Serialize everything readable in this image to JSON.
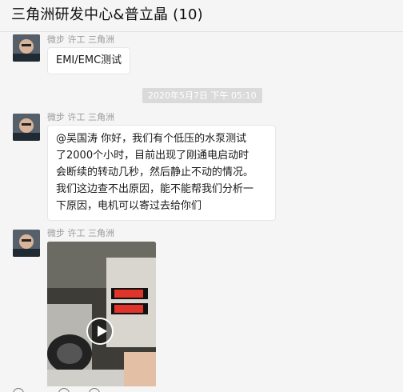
{
  "window": {
    "title": "三角洲研发中心&普立晶 (10)"
  },
  "messages": [
    {
      "sender": "微步  许工 三角洲",
      "text": "EMI/EMC测试"
    },
    {
      "sender": "微步  许工 三角洲",
      "lines": [
        "@吴国涛 你好，我们有个低压的水泵测试",
        "了2000个小时，目前出现了刚通电启动时",
        "会断续的转动几秒，然后静止不动的情况。",
        "我们这边查不出原因，能不能帮我们分析一",
        "下原因，电机可以寄过去给你们"
      ]
    },
    {
      "sender": "微步  许工 三角洲",
      "media": "video"
    }
  ],
  "timestamp": "2020年5月7日 下午 05:10",
  "icons": {
    "play": "play-icon",
    "avatar": "avatar-image"
  }
}
